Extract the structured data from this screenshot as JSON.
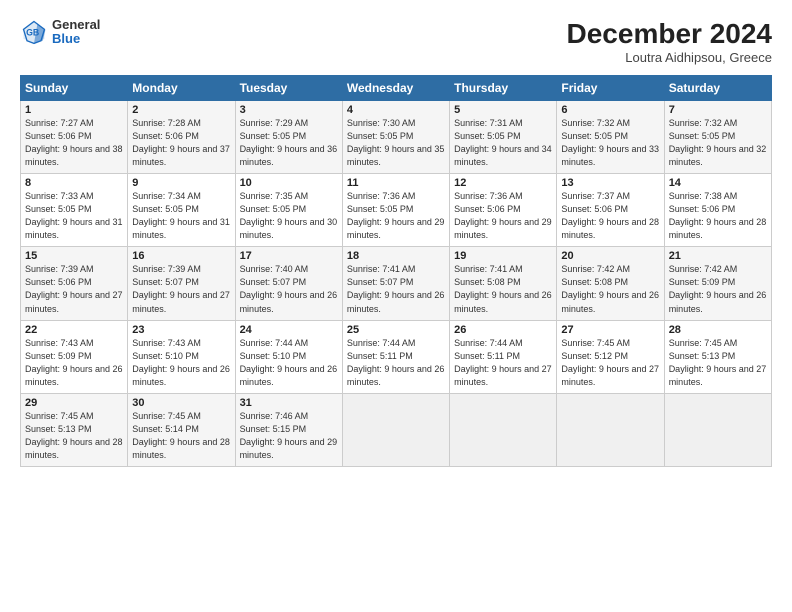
{
  "header": {
    "logo_general": "General",
    "logo_blue": "Blue",
    "month_title": "December 2024",
    "location": "Loutra Aidhipsou, Greece"
  },
  "days_of_week": [
    "Sunday",
    "Monday",
    "Tuesday",
    "Wednesday",
    "Thursday",
    "Friday",
    "Saturday"
  ],
  "weeks": [
    [
      {
        "day": "1",
        "sunrise": "Sunrise: 7:27 AM",
        "sunset": "Sunset: 5:06 PM",
        "daylight": "Daylight: 9 hours and 38 minutes."
      },
      {
        "day": "2",
        "sunrise": "Sunrise: 7:28 AM",
        "sunset": "Sunset: 5:06 PM",
        "daylight": "Daylight: 9 hours and 37 minutes."
      },
      {
        "day": "3",
        "sunrise": "Sunrise: 7:29 AM",
        "sunset": "Sunset: 5:05 PM",
        "daylight": "Daylight: 9 hours and 36 minutes."
      },
      {
        "day": "4",
        "sunrise": "Sunrise: 7:30 AM",
        "sunset": "Sunset: 5:05 PM",
        "daylight": "Daylight: 9 hours and 35 minutes."
      },
      {
        "day": "5",
        "sunrise": "Sunrise: 7:31 AM",
        "sunset": "Sunset: 5:05 PM",
        "daylight": "Daylight: 9 hours and 34 minutes."
      },
      {
        "day": "6",
        "sunrise": "Sunrise: 7:32 AM",
        "sunset": "Sunset: 5:05 PM",
        "daylight": "Daylight: 9 hours and 33 minutes."
      },
      {
        "day": "7",
        "sunrise": "Sunrise: 7:32 AM",
        "sunset": "Sunset: 5:05 PM",
        "daylight": "Daylight: 9 hours and 32 minutes."
      }
    ],
    [
      {
        "day": "8",
        "sunrise": "Sunrise: 7:33 AM",
        "sunset": "Sunset: 5:05 PM",
        "daylight": "Daylight: 9 hours and 31 minutes."
      },
      {
        "day": "9",
        "sunrise": "Sunrise: 7:34 AM",
        "sunset": "Sunset: 5:05 PM",
        "daylight": "Daylight: 9 hours and 31 minutes."
      },
      {
        "day": "10",
        "sunrise": "Sunrise: 7:35 AM",
        "sunset": "Sunset: 5:05 PM",
        "daylight": "Daylight: 9 hours and 30 minutes."
      },
      {
        "day": "11",
        "sunrise": "Sunrise: 7:36 AM",
        "sunset": "Sunset: 5:05 PM",
        "daylight": "Daylight: 9 hours and 29 minutes."
      },
      {
        "day": "12",
        "sunrise": "Sunrise: 7:36 AM",
        "sunset": "Sunset: 5:06 PM",
        "daylight": "Daylight: 9 hours and 29 minutes."
      },
      {
        "day": "13",
        "sunrise": "Sunrise: 7:37 AM",
        "sunset": "Sunset: 5:06 PM",
        "daylight": "Daylight: 9 hours and 28 minutes."
      },
      {
        "day": "14",
        "sunrise": "Sunrise: 7:38 AM",
        "sunset": "Sunset: 5:06 PM",
        "daylight": "Daylight: 9 hours and 28 minutes."
      }
    ],
    [
      {
        "day": "15",
        "sunrise": "Sunrise: 7:39 AM",
        "sunset": "Sunset: 5:06 PM",
        "daylight": "Daylight: 9 hours and 27 minutes."
      },
      {
        "day": "16",
        "sunrise": "Sunrise: 7:39 AM",
        "sunset": "Sunset: 5:07 PM",
        "daylight": "Daylight: 9 hours and 27 minutes."
      },
      {
        "day": "17",
        "sunrise": "Sunrise: 7:40 AM",
        "sunset": "Sunset: 5:07 PM",
        "daylight": "Daylight: 9 hours and 26 minutes."
      },
      {
        "day": "18",
        "sunrise": "Sunrise: 7:41 AM",
        "sunset": "Sunset: 5:07 PM",
        "daylight": "Daylight: 9 hours and 26 minutes."
      },
      {
        "day": "19",
        "sunrise": "Sunrise: 7:41 AM",
        "sunset": "Sunset: 5:08 PM",
        "daylight": "Daylight: 9 hours and 26 minutes."
      },
      {
        "day": "20",
        "sunrise": "Sunrise: 7:42 AM",
        "sunset": "Sunset: 5:08 PM",
        "daylight": "Daylight: 9 hours and 26 minutes."
      },
      {
        "day": "21",
        "sunrise": "Sunrise: 7:42 AM",
        "sunset": "Sunset: 5:09 PM",
        "daylight": "Daylight: 9 hours and 26 minutes."
      }
    ],
    [
      {
        "day": "22",
        "sunrise": "Sunrise: 7:43 AM",
        "sunset": "Sunset: 5:09 PM",
        "daylight": "Daylight: 9 hours and 26 minutes."
      },
      {
        "day": "23",
        "sunrise": "Sunrise: 7:43 AM",
        "sunset": "Sunset: 5:10 PM",
        "daylight": "Daylight: 9 hours and 26 minutes."
      },
      {
        "day": "24",
        "sunrise": "Sunrise: 7:44 AM",
        "sunset": "Sunset: 5:10 PM",
        "daylight": "Daylight: 9 hours and 26 minutes."
      },
      {
        "day": "25",
        "sunrise": "Sunrise: 7:44 AM",
        "sunset": "Sunset: 5:11 PM",
        "daylight": "Daylight: 9 hours and 26 minutes."
      },
      {
        "day": "26",
        "sunrise": "Sunrise: 7:44 AM",
        "sunset": "Sunset: 5:11 PM",
        "daylight": "Daylight: 9 hours and 27 minutes."
      },
      {
        "day": "27",
        "sunrise": "Sunrise: 7:45 AM",
        "sunset": "Sunset: 5:12 PM",
        "daylight": "Daylight: 9 hours and 27 minutes."
      },
      {
        "day": "28",
        "sunrise": "Sunrise: 7:45 AM",
        "sunset": "Sunset: 5:13 PM",
        "daylight": "Daylight: 9 hours and 27 minutes."
      }
    ],
    [
      {
        "day": "29",
        "sunrise": "Sunrise: 7:45 AM",
        "sunset": "Sunset: 5:13 PM",
        "daylight": "Daylight: 9 hours and 28 minutes."
      },
      {
        "day": "30",
        "sunrise": "Sunrise: 7:45 AM",
        "sunset": "Sunset: 5:14 PM",
        "daylight": "Daylight: 9 hours and 28 minutes."
      },
      {
        "day": "31",
        "sunrise": "Sunrise: 7:46 AM",
        "sunset": "Sunset: 5:15 PM",
        "daylight": "Daylight: 9 hours and 29 minutes."
      },
      null,
      null,
      null,
      null
    ]
  ]
}
